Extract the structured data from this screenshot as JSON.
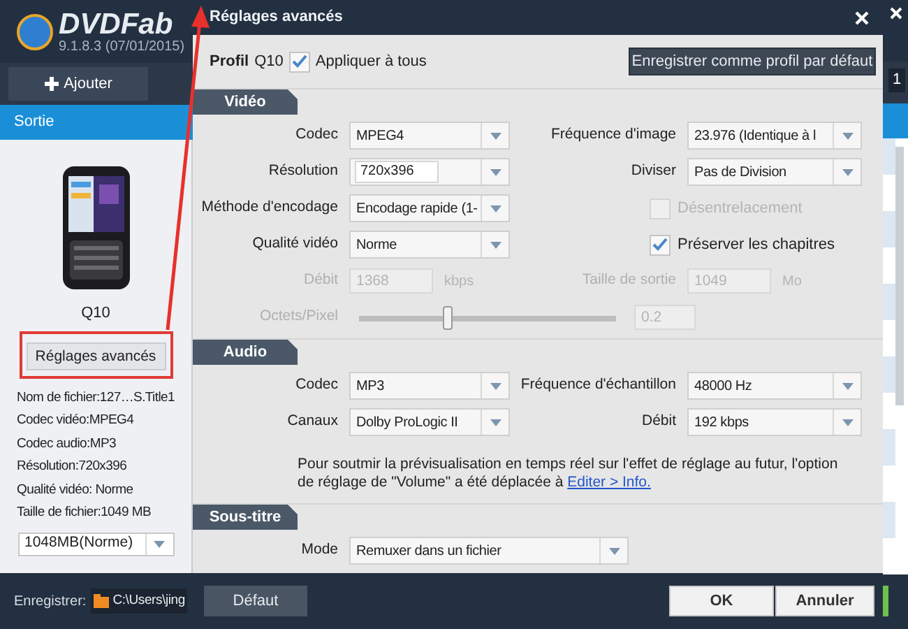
{
  "app": {
    "logo_text": "DVDFab",
    "version": "9.1.8.3 (07/01/2015)",
    "add_button": "Ajouter",
    "output_header": "Sortie",
    "profile_name": "Q10",
    "advanced_button": "Réglages avancés",
    "info": [
      "Nom de fichier:127…S.Title1",
      "Codec vidéo:MPEG4",
      "Codec audio:MP3",
      "Résolution:720x396",
      "Qualité vidéo: Norme",
      "Taille de fichier:1049 MB"
    ],
    "size_select": "1048MB(Norme)",
    "save_label": "Enregistrer:",
    "save_path": "C:\\Users\\jing",
    "badge": "1"
  },
  "dialog": {
    "title": "Réglages avancés",
    "profile_label": "Profil",
    "profile_value": "Q10",
    "apply_all": {
      "label": "Appliquer à tous",
      "checked": true
    },
    "save_default_button": "Enregistrer comme profil par défaut",
    "sections": [
      {
        "title": "Vidéo",
        "rows": [
          {
            "left": {
              "kind": "select",
              "label": "Codec",
              "value": "MPEG4"
            },
            "right": {
              "kind": "select",
              "label": "Fréquence d'image",
              "value": "23.976 (Identique à l"
            }
          },
          {
            "left": {
              "kind": "combo",
              "label": "Résolution",
              "value": "720x396"
            },
            "right": {
              "kind": "select",
              "label": "Diviser",
              "value": "Pas de Division"
            }
          },
          {
            "left": {
              "kind": "select",
              "label": "Méthode d'encodage",
              "value": "Encodage rapide (1-"
            },
            "right": {
              "kind": "checkbox",
              "label": "Désentrelacement",
              "checked": false,
              "disabled": true
            }
          },
          {
            "left": {
              "kind": "select",
              "label": "Qualité vidéo",
              "value": "Norme"
            },
            "right": {
              "kind": "checkbox",
              "label": "Préserver les chapitres",
              "checked": true,
              "disabled": false
            }
          },
          {
            "left": {
              "kind": "input",
              "label": "Débit",
              "value": "1368",
              "unit": "kbps",
              "disabled": true
            },
            "right": {
              "kind": "input",
              "label": "Taille de sortie",
              "value": "1049",
              "unit": "Mo",
              "disabled": true
            }
          },
          {
            "left": {
              "kind": "slider",
              "label": "Octets/Pixel",
              "level": 0.34,
              "value": "0.2",
              "disabled": true
            }
          }
        ]
      },
      {
        "title": "Audio",
        "rows": [
          {
            "left": {
              "kind": "select",
              "label": "Codec",
              "value": "MP3"
            },
            "right": {
              "kind": "select",
              "label": "Fréquence d'échantillon",
              "value": "48000 Hz"
            }
          },
          {
            "left": {
              "kind": "select",
              "label": "Canaux",
              "value": "Dolby ProLogic II"
            },
            "right": {
              "kind": "select",
              "label": "Débit",
              "value": "192 kbps"
            }
          }
        ],
        "note": {
          "text": "Pour soutmir la prévisualisation en temps réel sur l'effet de réglage au futur, l'option de réglage de \"Volume\" a été déplacée à",
          "link": "Editer > Info."
        }
      },
      {
        "title": "Sous-titre",
        "rows": [
          {
            "left": {
              "kind": "wide_select",
              "label": "Mode",
              "value": "Remuxer dans un fichier"
            }
          }
        ]
      }
    ],
    "footer": {
      "default_button": "Défaut",
      "ok_button": "OK",
      "cancel_button": "Annuler"
    }
  }
}
